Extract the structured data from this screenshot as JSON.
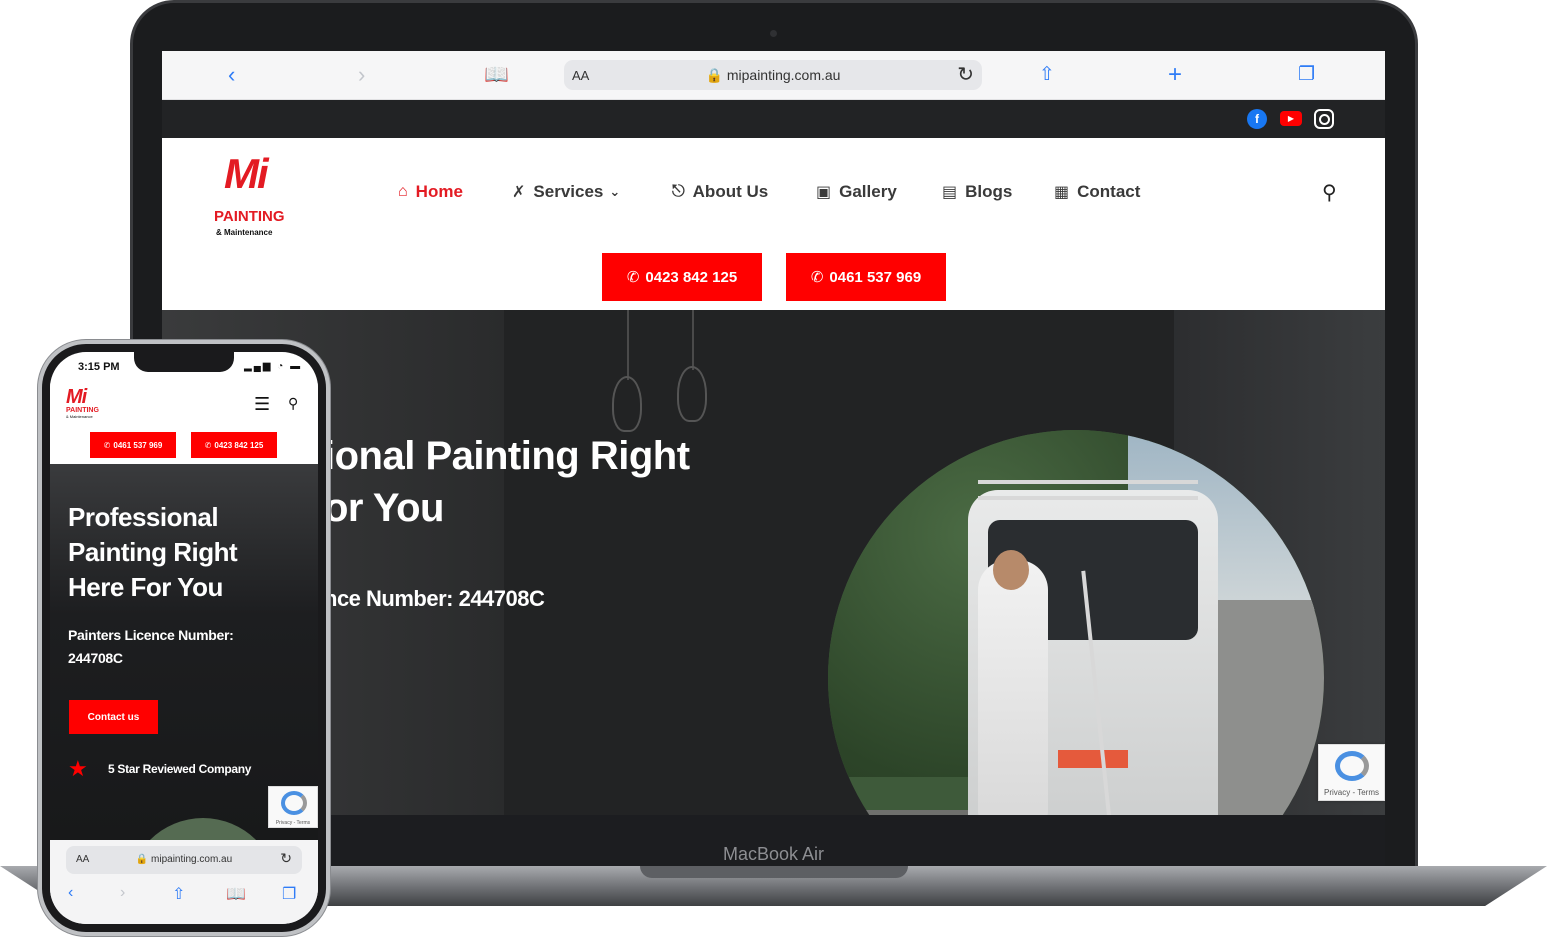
{
  "laptop": {
    "brand": "MacBook Air",
    "safari": {
      "back_icon": "chevron-left-icon",
      "forward_icon": "chevron-right-icon",
      "bookmarks_icon": "book-icon",
      "aa": "AA",
      "url": "🔒 mipainting.com.au",
      "reload_icon": "reload-icon",
      "share_icon": "share-icon",
      "new_tab_icon": "plus-icon",
      "tabs_icon": "tabs-icon"
    },
    "social": [
      "facebook-icon",
      "youtube-icon",
      "instagram-icon"
    ],
    "logo": {
      "mark": "Mi",
      "line1": "PAINTING",
      "line2": "& Maintenance"
    },
    "nav": [
      {
        "label": "Home",
        "icon": "home-icon",
        "active": true
      },
      {
        "label": "Services",
        "icon": "tools-icon",
        "dropdown": true
      },
      {
        "label": "About Us",
        "icon": "paint-roller-icon"
      },
      {
        "label": "Gallery",
        "icon": "image-icon"
      },
      {
        "label": "Blogs",
        "icon": "document-icon"
      },
      {
        "label": "Contact",
        "icon": "contact-card-icon"
      }
    ],
    "phones": [
      "0423 842 125",
      "0461 537 969"
    ],
    "hero": {
      "title_line1": "ional Painting Right",
      "title_line2": "or You",
      "licence": "nce Number: 244708C"
    },
    "captcha_text": "Privacy - Terms"
  },
  "phone": {
    "time": "3:15 PM",
    "status_icons": "▂▄▆ ◔ ▬",
    "logo": {
      "mark": "Mi",
      "line1": "PAINTING",
      "line2": "& Maintenance"
    },
    "phones": [
      "0461 537 969",
      "0423 842 125"
    ],
    "title": [
      "Professional",
      "Painting Right",
      "Here For You"
    ],
    "licence": [
      "Painters Licence Number:",
      "244708C"
    ],
    "contact_button": "Contact us",
    "review_text": "5 Star Reviewed Company",
    "captcha_text": "Privacy - Terms",
    "safari": {
      "aa": "AA",
      "url": "🔒 mipainting.com.au"
    }
  },
  "colors": {
    "accent": "#ff0000",
    "brand_red": "#e31b23",
    "safari_blue": "#2f7cf6"
  }
}
